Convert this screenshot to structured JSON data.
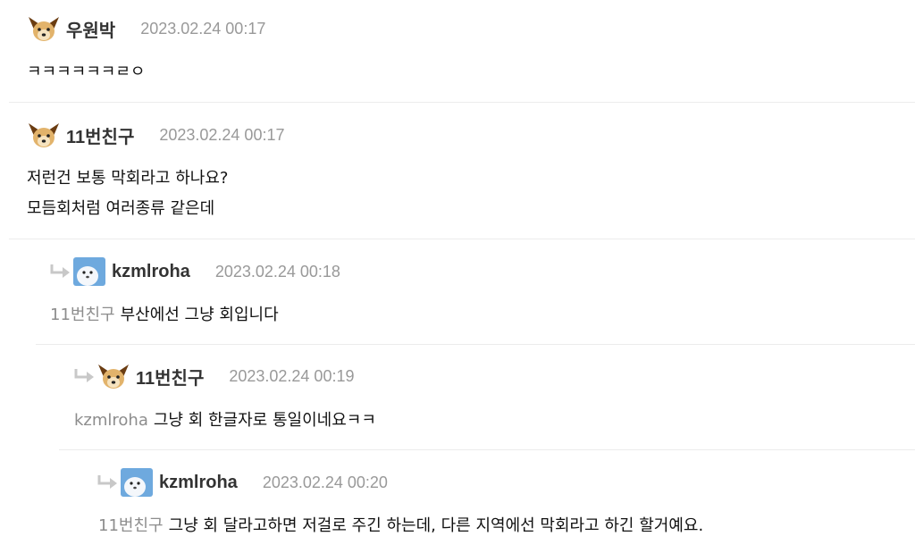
{
  "comments": [
    {
      "nick": "우원박",
      "date": "2023.02.24 00:17",
      "avatar": "dog-avatar-icon",
      "lines": [
        "ㅋㅋㅋㅋㅋㅋㄹㅇ"
      ]
    },
    {
      "nick": "11번친구",
      "date": "2023.02.24 00:17",
      "avatar": "dog-avatar-icon",
      "lines": [
        "저런건 보통 막회라고 하나요?",
        "모듬회처럼 여러종류 같은데"
      ]
    },
    {
      "nick": "kzmlroha",
      "date": "2023.02.24 00:18",
      "avatar": "seal-avatar-icon",
      "mention": "11번친구",
      "text": "부산에선 그냥 회입니다"
    },
    {
      "nick": "11번친구",
      "date": "2023.02.24 00:19",
      "avatar": "dog-avatar-icon",
      "mention": "kzmlroha",
      "text": "그냥 회 한글자로 통일이네요ㅋㅋ"
    },
    {
      "nick": "kzmlroha",
      "date": "2023.02.24 00:20",
      "avatar": "seal-avatar-icon",
      "mention": "11번친구",
      "text": "그냥 회 달라고하면 저걸로 주긴 하는데, 다른 지역에선 막회라고 하긴 할거예요."
    }
  ],
  "colors": {
    "mention": "#8d8d8d",
    "date": "#999999",
    "nick": "#333333",
    "divider": "#ececec",
    "reply_arrow": "#c8c8c8"
  }
}
